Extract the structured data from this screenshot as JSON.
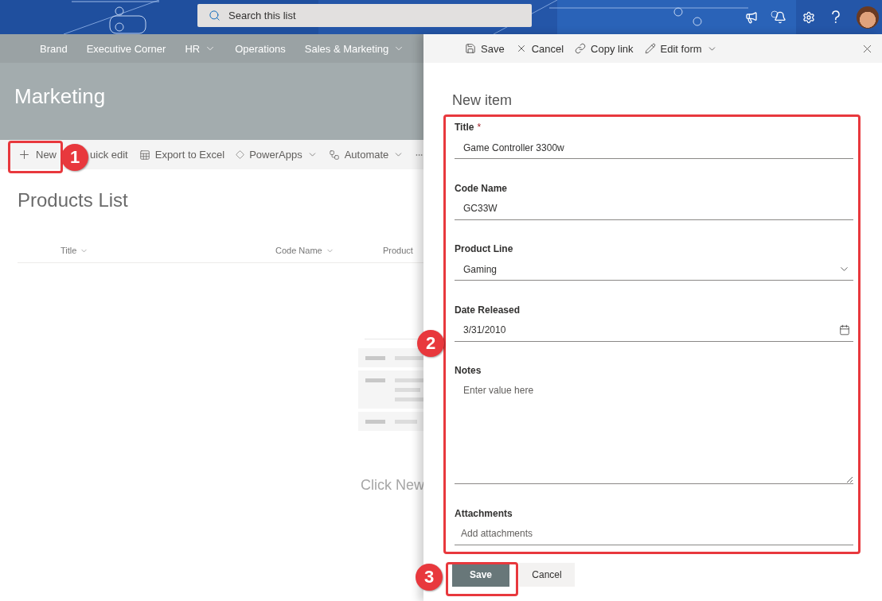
{
  "header": {
    "search": {
      "placeholder": "Search this list"
    }
  },
  "site_nav": {
    "items": [
      {
        "label": "Brand",
        "has_menu": false
      },
      {
        "label": "Executive Corner",
        "has_menu": false
      },
      {
        "label": "HR",
        "has_menu": true
      },
      {
        "label": "Operations",
        "has_menu": false
      },
      {
        "label": "Sales & Marketing",
        "has_menu": true
      }
    ]
  },
  "site": {
    "title": "Marketing"
  },
  "command_bar": {
    "items": [
      {
        "kind": "new",
        "label": "New",
        "has_menu": false
      },
      {
        "kind": "quick_edit",
        "label": "uick edit",
        "has_menu": false
      },
      {
        "kind": "export",
        "label": "Export to Excel",
        "has_menu": false
      },
      {
        "kind": "powerapps",
        "label": "PowerApps",
        "has_menu": true
      },
      {
        "kind": "automate",
        "label": "Automate",
        "has_menu": true
      }
    ]
  },
  "list": {
    "title": "Products List",
    "columns": [
      {
        "label": "Title",
        "has_menu": true
      },
      {
        "label": "Code Name",
        "has_menu": true
      },
      {
        "label": "Product",
        "has_menu": false
      }
    ],
    "empty_text": "Click New"
  },
  "panel": {
    "commands": [
      {
        "kind": "save",
        "label": "Save",
        "has_menu": false
      },
      {
        "kind": "cancel",
        "label": "Cancel",
        "has_menu": false
      },
      {
        "kind": "copy_link",
        "label": "Copy link",
        "has_menu": false
      },
      {
        "kind": "edit_form",
        "label": "Edit form",
        "has_menu": true
      }
    ],
    "title": "New item",
    "fields": [
      {
        "kind": "text",
        "label": "Title",
        "required_mark": "*",
        "value": "Game Controller 3300w"
      },
      {
        "kind": "text",
        "label": "Code Name",
        "value": "GC33W"
      },
      {
        "kind": "choice",
        "label": "Product Line",
        "value": "Gaming"
      },
      {
        "kind": "date",
        "label": "Date Released",
        "value": "3/31/2010"
      },
      {
        "kind": "multiline",
        "label": "Notes",
        "placeholder": "Enter value here"
      },
      {
        "kind": "attachments",
        "label": "Attachments",
        "placeholder": "Add attachments"
      }
    ],
    "buttons": [
      {
        "label": "Save",
        "primary": true
      },
      {
        "label": "Cancel",
        "primary": false
      }
    ]
  },
  "annotations": [
    {
      "number": "1"
    },
    {
      "number": "2"
    },
    {
      "number": "3"
    }
  ]
}
